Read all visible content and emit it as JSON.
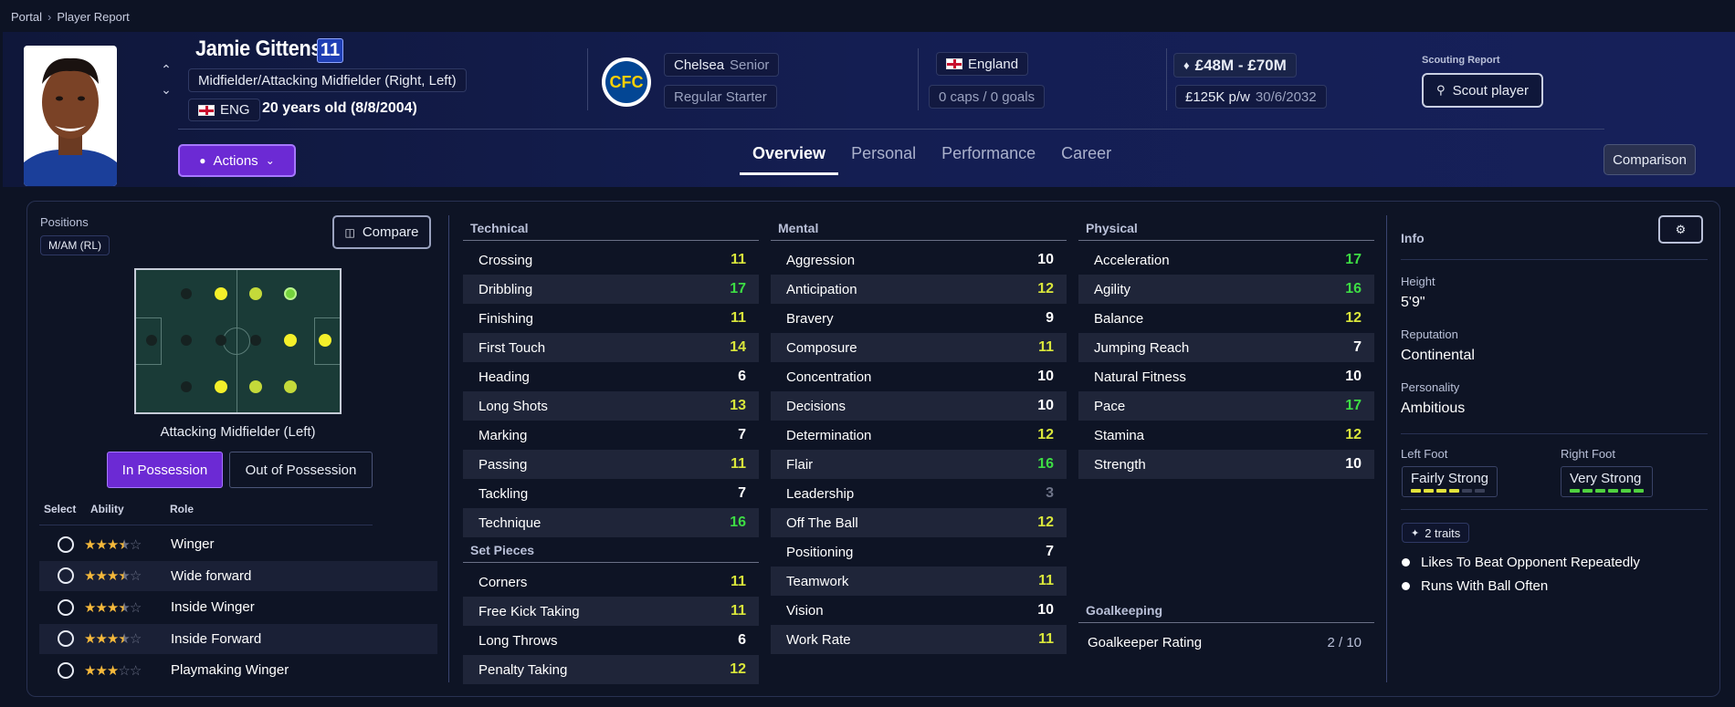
{
  "breadcrumb": {
    "items": [
      "Portal",
      "Player Report"
    ]
  },
  "player": {
    "name": "Jamie Gittens",
    "number": "11",
    "positions": "Midfielder/Attacking Midfielder (Right, Left)",
    "nationality_code": "ENG",
    "age_text": "20 years old (8/8/2004)"
  },
  "club": {
    "name": "Chelsea",
    "squad": "Senior",
    "status": "Regular Starter",
    "badge_text": "CFC"
  },
  "country": {
    "name": "England",
    "caps": "0 caps / 0 goals"
  },
  "contract": {
    "value": "£48M - £70M",
    "wage": "£125K p/w",
    "expiry": "30/6/2032"
  },
  "scouting": {
    "label": "Scouting Report",
    "button": "Scout player"
  },
  "actions_label": "Actions",
  "tabs": [
    "Overview",
    "Personal",
    "Performance",
    "Career"
  ],
  "comparison_label": "Comparison",
  "positions_panel": {
    "label": "Positions",
    "tag": "M/AM (RL)",
    "compare": "Compare",
    "selected_role": "Attacking Midfielder (Left)",
    "in_possession": "In Possession",
    "out_possession": "Out of Possession",
    "headers": {
      "select": "Select",
      "ability": "Ability",
      "role": "Role"
    }
  },
  "roles": [
    {
      "name": "Winger",
      "stars": 3.5
    },
    {
      "name": "Wide forward",
      "stars": 3.5
    },
    {
      "name": "Inside Winger",
      "stars": 3.5
    },
    {
      "name": "Inside Forward",
      "stars": 3.5
    },
    {
      "name": "Playmaking Winger",
      "stars": 3
    }
  ],
  "technical": {
    "title": "Technical",
    "items": [
      {
        "name": "Crossing",
        "value": "11",
        "tone": "y"
      },
      {
        "name": "Dribbling",
        "value": "17",
        "tone": "g"
      },
      {
        "name": "Finishing",
        "value": "11",
        "tone": "y"
      },
      {
        "name": "First Touch",
        "value": "14",
        "tone": "y"
      },
      {
        "name": "Heading",
        "value": "6",
        "tone": "w"
      },
      {
        "name": "Long Shots",
        "value": "13",
        "tone": "y"
      },
      {
        "name": "Marking",
        "value": "7",
        "tone": "w"
      },
      {
        "name": "Passing",
        "value": "11",
        "tone": "y"
      },
      {
        "name": "Tackling",
        "value": "7",
        "tone": "w"
      },
      {
        "name": "Technique",
        "value": "16",
        "tone": "g"
      }
    ]
  },
  "set_pieces": {
    "title": "Set Pieces",
    "items": [
      {
        "name": "Corners",
        "value": "11",
        "tone": "y"
      },
      {
        "name": "Free Kick Taking",
        "value": "11",
        "tone": "y"
      },
      {
        "name": "Long Throws",
        "value": "6",
        "tone": "w"
      },
      {
        "name": "Penalty Taking",
        "value": "12",
        "tone": "y"
      }
    ]
  },
  "mental": {
    "title": "Mental",
    "items": [
      {
        "name": "Aggression",
        "value": "10",
        "tone": "w"
      },
      {
        "name": "Anticipation",
        "value": "12",
        "tone": "y"
      },
      {
        "name": "Bravery",
        "value": "9",
        "tone": "w"
      },
      {
        "name": "Composure",
        "value": "11",
        "tone": "y"
      },
      {
        "name": "Concentration",
        "value": "10",
        "tone": "w"
      },
      {
        "name": "Decisions",
        "value": "10",
        "tone": "w"
      },
      {
        "name": "Determination",
        "value": "12",
        "tone": "y"
      },
      {
        "name": "Flair",
        "value": "16",
        "tone": "g"
      },
      {
        "name": "Leadership",
        "value": "3",
        "tone": "gr"
      },
      {
        "name": "Off The Ball",
        "value": "12",
        "tone": "y"
      },
      {
        "name": "Positioning",
        "value": "7",
        "tone": "w"
      },
      {
        "name": "Teamwork",
        "value": "11",
        "tone": "y"
      },
      {
        "name": "Vision",
        "value": "10",
        "tone": "w"
      },
      {
        "name": "Work Rate",
        "value": "11",
        "tone": "y"
      }
    ]
  },
  "physical": {
    "title": "Physical",
    "items": [
      {
        "name": "Acceleration",
        "value": "17",
        "tone": "g"
      },
      {
        "name": "Agility",
        "value": "16",
        "tone": "g"
      },
      {
        "name": "Balance",
        "value": "12",
        "tone": "y"
      },
      {
        "name": "Jumping Reach",
        "value": "7",
        "tone": "w"
      },
      {
        "name": "Natural Fitness",
        "value": "10",
        "tone": "w"
      },
      {
        "name": "Pace",
        "value": "17",
        "tone": "g"
      },
      {
        "name": "Stamina",
        "value": "12",
        "tone": "y"
      },
      {
        "name": "Strength",
        "value": "10",
        "tone": "w"
      }
    ]
  },
  "goalkeeping": {
    "title": "Goalkeeping",
    "rating_label": "Goalkeeper Rating",
    "rating_value": "2 / 10"
  },
  "info": {
    "title": "Info",
    "height_label": "Height",
    "height": "5'9\"",
    "reputation_label": "Reputation",
    "reputation": "Continental",
    "personality_label": "Personality",
    "personality": "Ambitious",
    "left_foot_label": "Left Foot",
    "left_foot": "Fairly Strong",
    "left_foot_level": 4,
    "right_foot_label": "Right Foot",
    "right_foot": "Very Strong",
    "right_foot_level": 6,
    "traits_label": "2 traits",
    "traits": [
      "Likes To Beat Opponent Repeatedly",
      "Runs With Ball Often"
    ]
  },
  "colors": {
    "accent_purple": "#6c2ad4",
    "attr_yellow": "#d9e63b",
    "attr_green": "#3ddc44"
  }
}
